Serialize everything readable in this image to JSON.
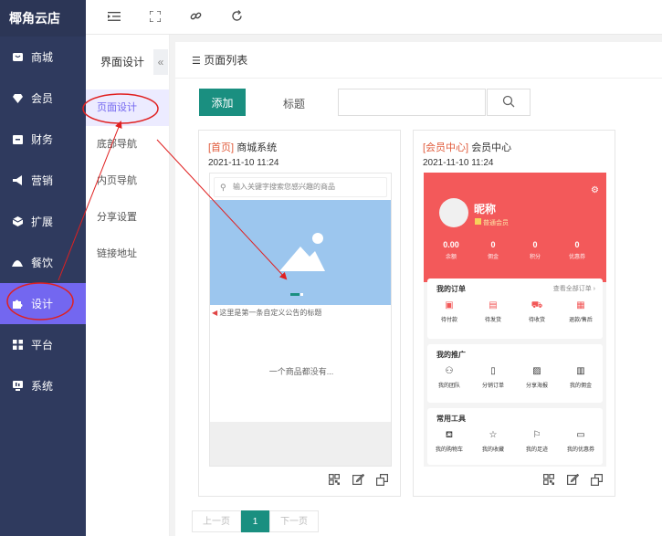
{
  "brand": "椰角云店",
  "nav": [
    {
      "label": "商城",
      "icon": "mall-icon"
    },
    {
      "label": "会员",
      "icon": "diamond-icon"
    },
    {
      "label": "财务",
      "icon": "wallet-icon"
    },
    {
      "label": "营销",
      "icon": "megaphone-icon"
    },
    {
      "label": "扩展",
      "icon": "cube-icon"
    },
    {
      "label": "餐饮",
      "icon": "food-icon"
    },
    {
      "label": "设计",
      "icon": "puzzle-icon",
      "active": true
    },
    {
      "label": "平台",
      "icon": "grid-icon"
    },
    {
      "label": "系统",
      "icon": "monitor-icon"
    }
  ],
  "subnav": {
    "title": "界面设计",
    "collapse": "«",
    "items": [
      "页面设计",
      "底部导航",
      "内页导航",
      "分享设置",
      "链接地址"
    ]
  },
  "main": {
    "header": "页面列表",
    "add_label": "添加",
    "title_label": "标题",
    "title_value": ""
  },
  "cards": [
    {
      "tag": "[首页]",
      "name": "商城系统",
      "date": "2021-11-10 11:24",
      "search_placeholder": "输入关键字搜索您感兴趣的商品",
      "notice": "这里是第一条自定义公告的标题",
      "empty": "一个商品都没有..."
    },
    {
      "tag": "[会员中心]",
      "name": "会员中心",
      "date": "2021-11-10 11:24",
      "nickname": "昵称",
      "level": "普通会员",
      "stats": [
        {
          "value": "0.00",
          "label": "余额"
        },
        {
          "value": "0",
          "label": "佣金"
        },
        {
          "value": "0",
          "label": "积分"
        },
        {
          "value": "0",
          "label": "优惠券"
        }
      ],
      "orders": {
        "title": "我的订单",
        "more": "查看全部订单 ›",
        "items": [
          "待付款",
          "待发货",
          "待收货",
          "退款/售后"
        ]
      },
      "promo": {
        "title": "我的推广",
        "items": [
          "我的团队",
          "分销订单",
          "分享海报",
          "我的佣金"
        ]
      },
      "tools": {
        "title": "常用工具",
        "items": [
          "我的购物车",
          "我的收藏",
          "我的足迹",
          "我的优惠券"
        ]
      }
    }
  ],
  "pager": {
    "prev": "上一页",
    "current": "1",
    "next": "下一页"
  },
  "colors": {
    "sidebar": "#2f3a5e",
    "accent": "#7367f0",
    "primary": "#1a8f80",
    "member_red": "#f3595a"
  }
}
